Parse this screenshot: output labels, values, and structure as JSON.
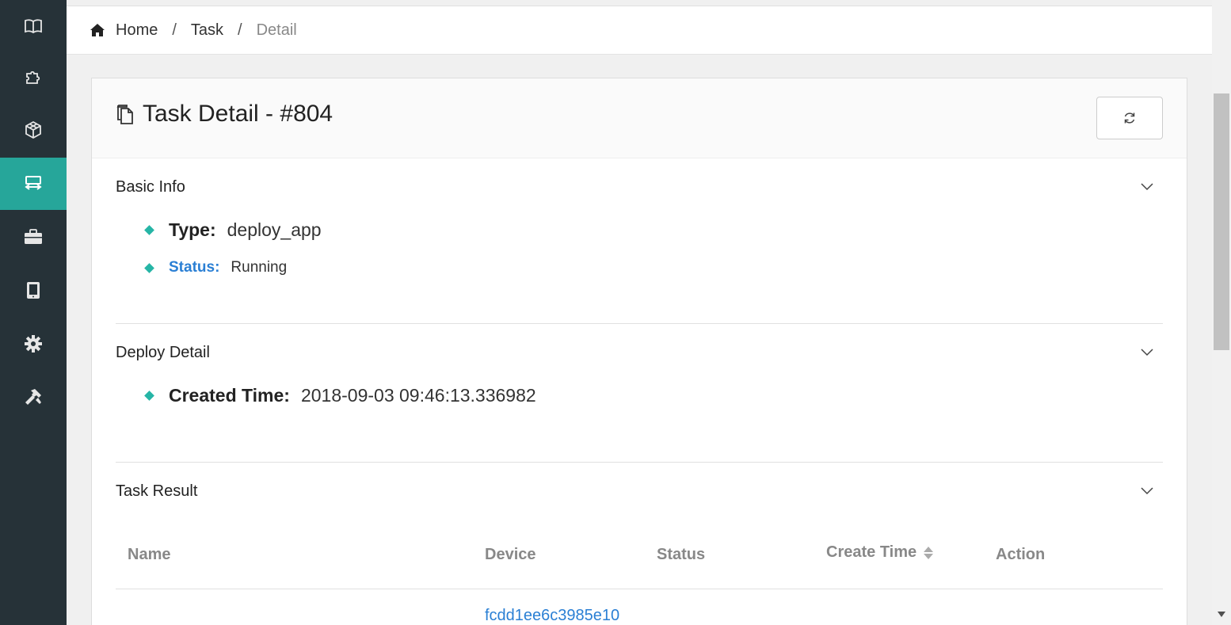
{
  "sidebar": {
    "items": [
      {
        "icon": "book-icon",
        "active": false
      },
      {
        "icon": "puzzle-icon",
        "active": false
      },
      {
        "icon": "cube-icon",
        "active": false
      },
      {
        "icon": "task-transfer-icon",
        "active": true
      },
      {
        "icon": "briefcase-icon",
        "active": false
      },
      {
        "icon": "tablet-icon",
        "active": false
      },
      {
        "icon": "gear-icon",
        "active": false
      },
      {
        "icon": "tools-icon",
        "active": false
      }
    ],
    "active_color": "#26a69a",
    "bg_color": "#263238"
  },
  "breadcrumb": {
    "items": [
      "Home",
      "Task",
      "Detail"
    ],
    "separator": "/"
  },
  "card": {
    "title": "Task Detail - #804",
    "refresh_icon": "refresh-icon"
  },
  "basic_info": {
    "title": "Basic Info",
    "type_label": "Type:",
    "type_value": "deploy_app",
    "status_label": "Status:",
    "status_value": "Running"
  },
  "deploy_detail": {
    "title": "Deploy Detail",
    "created_label": "Created Time:",
    "created_value": "2018-09-03 09:46:13.336982"
  },
  "task_result": {
    "title": "Task Result",
    "columns": [
      "Name",
      "Device",
      "Status",
      "Create Time",
      "Action"
    ],
    "rows": [
      {
        "name": "",
        "device": "fcdd1ee6c3985e10",
        "status": "",
        "create_time": "",
        "action": ""
      }
    ]
  },
  "colors": {
    "accent": "#26a69a",
    "link": "#2a7fd4",
    "bullet": "#26b5a6"
  }
}
